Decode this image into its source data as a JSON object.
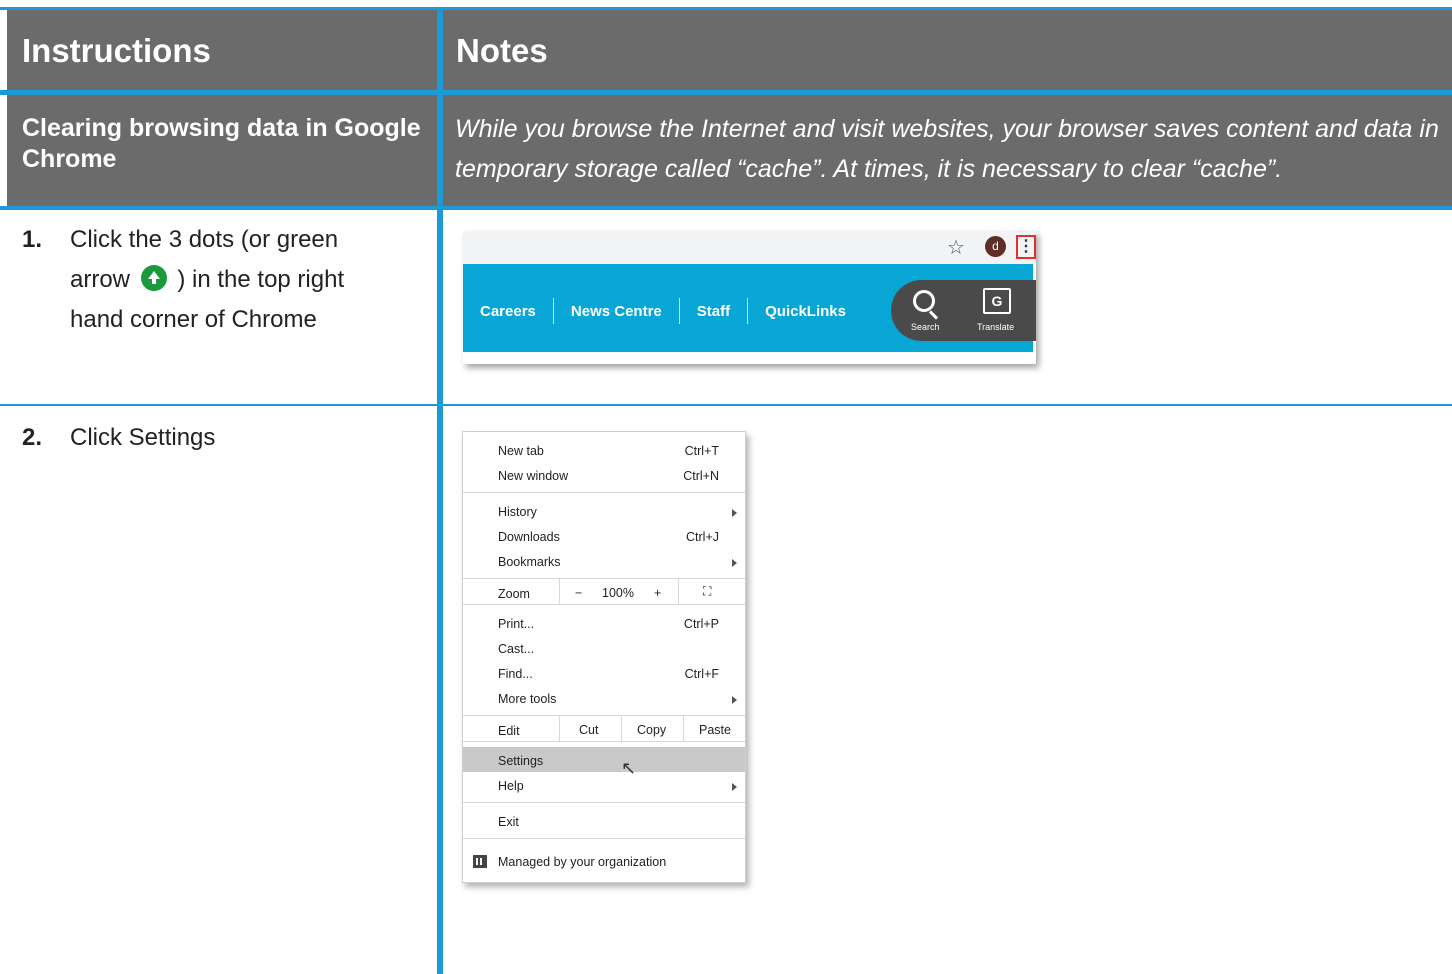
{
  "header": {
    "instructions_title": "Instructions",
    "notes_title": "Notes"
  },
  "subheader": {
    "left": "Clearing browsing data in Google Chrome",
    "right": "While you browse the Internet and visit websites, your browser saves content and data in temporary storage called “cache”. At times, it is necessary to clear “cache”."
  },
  "steps": [
    {
      "number": "1.",
      "text_before": "Click the 3 dots (or green arrow",
      "text_after": ") in the top right hand corner of Chrome",
      "icon": "green-arrow-icon"
    },
    {
      "number": "2.",
      "text": "Click Settings"
    }
  ],
  "screenshot1": {
    "avatar_letter": "d",
    "star_glyph": "☆",
    "dots_glyph": "⋮",
    "nav_links": [
      "Careers",
      "News Centre",
      "Staff",
      "QuickLinks"
    ],
    "search_label": "Search",
    "translate_label": "Translate",
    "translate_glyph": "G",
    "nav_color": "#08a6d5"
  },
  "menu": {
    "new_tab": "New tab",
    "new_tab_sc": "Ctrl+T",
    "new_window": "New window",
    "new_window_sc": "Ctrl+N",
    "history": "History",
    "downloads": "Downloads",
    "downloads_sc": "Ctrl+J",
    "bookmarks": "Bookmarks",
    "zoom": "Zoom",
    "zoom_minus": "−",
    "zoom_value": "100%",
    "zoom_plus": "+",
    "fullscreen_glyph": "⛶",
    "print": "Print...",
    "print_sc": "Ctrl+P",
    "cast": "Cast...",
    "find": "Find...",
    "find_sc": "Ctrl+F",
    "more_tools": "More tools",
    "edit": "Edit",
    "cut": "Cut",
    "copy": "Copy",
    "paste": "Paste",
    "settings": "Settings",
    "help": "Help",
    "exit": "Exit",
    "managed": "Managed by your organization"
  },
  "colors": {
    "accent_blue": "#1b9ad6",
    "header_gray": "#6b6b6b",
    "green_arrow": "#1a9a3c"
  }
}
